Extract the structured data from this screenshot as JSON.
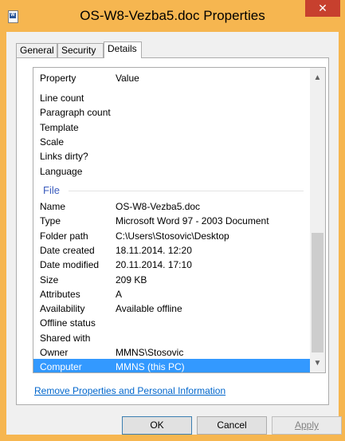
{
  "window": {
    "title": "OS-W8-Vezba5.doc Properties",
    "close_glyph": "✕",
    "accent": "#f6b650",
    "close_color": "#c7402e"
  },
  "tabs": [
    "General",
    "Security",
    "Details"
  ],
  "active_tab": "Details",
  "list": {
    "header": {
      "property": "Property",
      "value": "Value"
    },
    "rows_top": [
      {
        "property": "Line count",
        "value": ""
      },
      {
        "property": "Paragraph count",
        "value": ""
      },
      {
        "property": "Template",
        "value": ""
      },
      {
        "property": "Scale",
        "value": ""
      },
      {
        "property": "Links dirty?",
        "value": ""
      },
      {
        "property": "Language",
        "value": ""
      }
    ],
    "group_label": "File",
    "rows_file": [
      {
        "property": "Name",
        "value": "OS-W8-Vezba5.doc"
      },
      {
        "property": "Type",
        "value": "Microsoft Word 97 - 2003 Document"
      },
      {
        "property": "Folder path",
        "value": "C:\\Users\\Stosovic\\Desktop"
      },
      {
        "property": "Date created",
        "value": "18.11.2014. 12:20"
      },
      {
        "property": "Date modified",
        "value": "20.11.2014. 17:10"
      },
      {
        "property": "Size",
        "value": "209 KB"
      },
      {
        "property": "Attributes",
        "value": "A"
      },
      {
        "property": "Availability",
        "value": "Available offline"
      },
      {
        "property": "Offline status",
        "value": ""
      },
      {
        "property": "Shared with",
        "value": ""
      },
      {
        "property": "Owner",
        "value": "MMNS\\Stosovic"
      },
      {
        "property": "Computer",
        "value": "MMNS (this PC)"
      }
    ],
    "selected_row": "Computer",
    "selection_color": "#3399ff"
  },
  "remove_link": "Remove Properties and Personal Information",
  "buttons": {
    "ok": "OK",
    "cancel": "Cancel",
    "apply": "Apply"
  }
}
